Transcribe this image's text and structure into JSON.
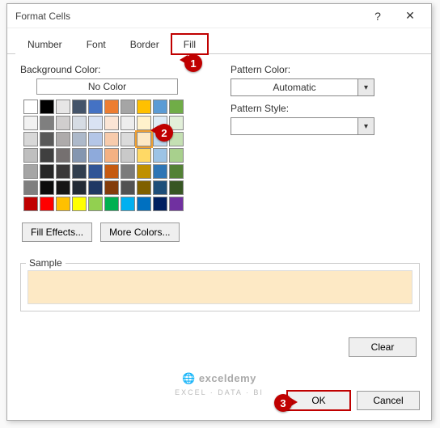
{
  "title": "Format Cells",
  "tabs": {
    "number": "Number",
    "font": "Font",
    "border": "Border",
    "fill": "Fill"
  },
  "labels": {
    "backgroundColor": "Background Color:",
    "noColor": "No Color",
    "patternColor": "Pattern Color:",
    "patternStyle": "Pattern Style:",
    "sample": "Sample"
  },
  "buttons": {
    "fillEffects": "Fill Effects...",
    "moreColors": "More Colors...",
    "clear": "Clear",
    "ok": "OK",
    "cancel": "Cancel",
    "help": "?",
    "close": "✕"
  },
  "patternColorValue": "Automatic",
  "callouts": {
    "one": "1",
    "two": "2",
    "three": "3"
  },
  "watermark": {
    "brand": "exceldemy",
    "tag": "EXCEL · DATA · BI"
  },
  "swatchRows": [
    [
      "#ffffff",
      "#000000",
      "#e7e6e6",
      "#44546a",
      "#4472c4",
      "#ed7d31",
      "#a5a5a5",
      "#ffc000",
      "#5b9bd5",
      "#70ad47"
    ],
    [
      "#f2f2f2",
      "#7f7f7f",
      "#d0cece",
      "#d6dce4",
      "#d9e2f3",
      "#fbe5d5",
      "#ededed",
      "#fff2cc",
      "#deebf6",
      "#e2efd9"
    ],
    [
      "#d8d8d8",
      "#595959",
      "#aeabab",
      "#adb9ca",
      "#b4c6e7",
      "#f7cbac",
      "#dbdbdb",
      "#fde9c5",
      "#bdd7ee",
      "#c5e0b3"
    ],
    [
      "#bfbfbf",
      "#3f3f3f",
      "#757070",
      "#8496b0",
      "#8eaadb",
      "#f4b183",
      "#c9c9c9",
      "#ffd965",
      "#9cc3e5",
      "#a8d08d"
    ],
    [
      "#a5a5a5",
      "#262626",
      "#3a3838",
      "#323f4f",
      "#2f5496",
      "#c55a11",
      "#7b7b7b",
      "#bf9000",
      "#2e75b5",
      "#538135"
    ],
    [
      "#7f7f7f",
      "#0c0c0c",
      "#171616",
      "#222a35",
      "#1f3864",
      "#833c0b",
      "#525252",
      "#7f6000",
      "#1e4e79",
      "#375623"
    ],
    [
      "#c00000",
      "#ff0000",
      "#ffc000",
      "#ffff00",
      "#92d050",
      "#00b050",
      "#00b0f0",
      "#0070c0",
      "#002060",
      "#7030a0"
    ]
  ],
  "selectedSwatch": {
    "row": 2,
    "col": 7
  }
}
